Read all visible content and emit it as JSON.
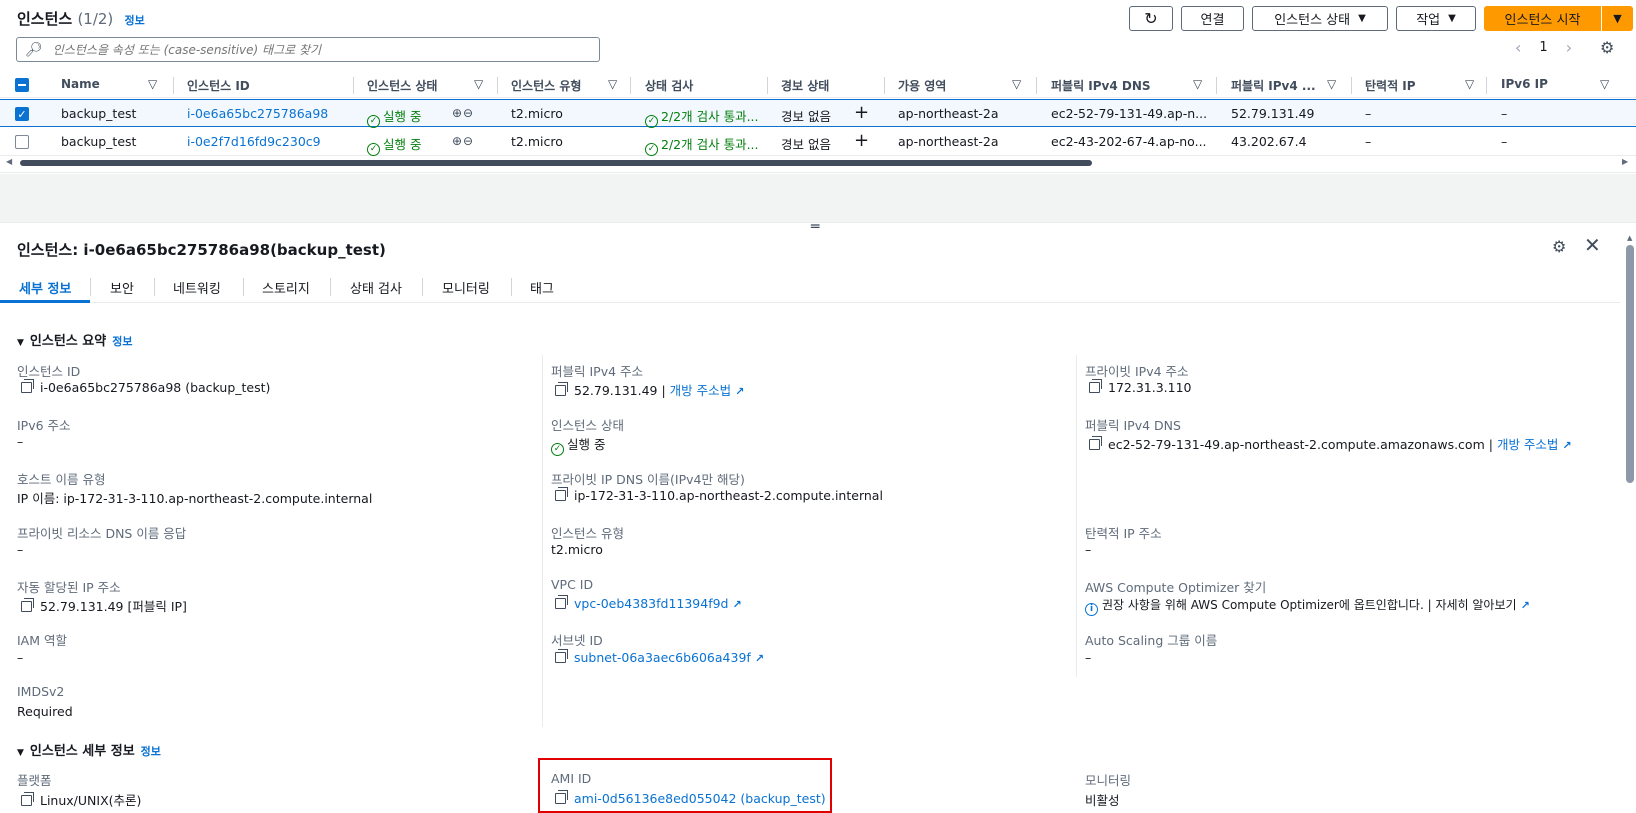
{
  "header": {
    "title": "인스턴스",
    "count": "(1/2)",
    "info": "정보",
    "refresh_icon": "refresh-icon",
    "connect": "연결",
    "instance_state": "인스턴스 상태",
    "actions": "작업",
    "launch": "인스턴스 시작",
    "search_placeholder": "인스턴스을 속성 또는 (case-sensitive) 태그로 찾기",
    "page": "1"
  },
  "table": {
    "columns": [
      "Name",
      "인스턴스 ID",
      "인스턴스 상태",
      "인스턴스 유형",
      "상태 검사",
      "경보 상태",
      "가용 영역",
      "퍼블릭 IPv4 DNS",
      "퍼블릭 IPv4 ...",
      "탄력적 IP",
      "IPv6 IP"
    ],
    "rows": [
      {
        "selected": true,
        "name": "backup_test",
        "id": "i-0e6a65bc275786a98",
        "state": "실행 중",
        "type": "t2.micro",
        "check": "2/2개 검사 통과...",
        "alarm": "경보 없음",
        "az": "ap-northeast-2a",
        "dns": "ec2-52-79-131-49.ap-n...",
        "ipv4": "52.79.131.49",
        "eip": "–",
        "ipv6": "–"
      },
      {
        "selected": false,
        "name": "backup_test",
        "id": "i-0e2f7d16fd9c230c9",
        "state": "실행 중",
        "type": "t2.micro",
        "check": "2/2개 검사 통과...",
        "alarm": "경보 없음",
        "az": "ap-northeast-2a",
        "dns": "ec2-43-202-67-4.ap-no...",
        "ipv4": "43.202.67.4",
        "eip": "–",
        "ipv6": "–"
      }
    ]
  },
  "detail": {
    "title": "인스턴스: i-0e6a65bc275786a98(backup_test)",
    "tabs": [
      "세부 정보",
      "보안",
      "네트워킹",
      "스토리지",
      "상태 검사",
      "모니터링",
      "태그"
    ],
    "summary_title": "인스턴스 요약",
    "info": "정보",
    "fields": {
      "instance_id_label": "인스턴스 ID",
      "instance_id": "i-0e6a65bc275786a98 (backup_test)",
      "public_ipv4_label": "퍼블릭 IPv4 주소",
      "public_ipv4": "52.79.131.49 |",
      "open_address": "개방 주소법",
      "private_ipv4_label": "프라이빗 IPv4 주소",
      "private_ipv4": "172.31.3.110",
      "ipv6_label": "IPv6 주소",
      "ipv6": "–",
      "state_label": "인스턴스 상태",
      "state": "실행 중",
      "public_dns_label": "퍼블릭 IPv4 DNS",
      "public_dns": "ec2-52-79-131-49.ap-northeast-2.compute.amazonaws.com |",
      "open_address2": "개방 주소법",
      "hostname_type_label": "호스트 이름 유형",
      "hostname_type": "IP 이름: ip-172-31-3-110.ap-northeast-2.compute.internal",
      "private_dns_label": "프라이빗 IP DNS 이름(IPv4만 해당)",
      "private_dns": "ip-172-31-3-110.ap-northeast-2.compute.internal",
      "private_resource_dns_label": "프라이빗 리소스 DNS 이름 응답",
      "private_resource_dns": "–",
      "instance_type_label": "인스턴스 유형",
      "instance_type": "t2.micro",
      "eip_label": "탄력적 IP 주소",
      "eip": "–",
      "auto_ip_label": "자동 할당된 IP 주소",
      "auto_ip": "52.79.131.49 [퍼블릭 IP]",
      "vpc_label": "VPC ID",
      "vpc": "vpc-0eb4383fd11394f9d",
      "optimizer_label": "AWS Compute Optimizer 찾기",
      "optimizer": "권장 사항을 위해 AWS Compute Optimizer에 옵트인합니다. |",
      "learn_more": "자세히 알아보기",
      "iam_label": "IAM 역할",
      "iam": "–",
      "subnet_label": "서브넷 ID",
      "subnet": "subnet-06a3aec6b606a439f",
      "asg_label": "Auto Scaling 그룹 이름",
      "asg": "–",
      "imds_label": "IMDSv2",
      "imds": "Required"
    },
    "details_title": "인스턴스 세부 정보",
    "details_info": "정보",
    "platform_label": "플랫폼",
    "platform": "Linux/UNIX(추론)",
    "ami_label": "AMI ID",
    "ami": "ami-0d56136e8ed055042 (backup_test)",
    "monitoring_label": "모니터링",
    "monitoring": "비활성"
  }
}
